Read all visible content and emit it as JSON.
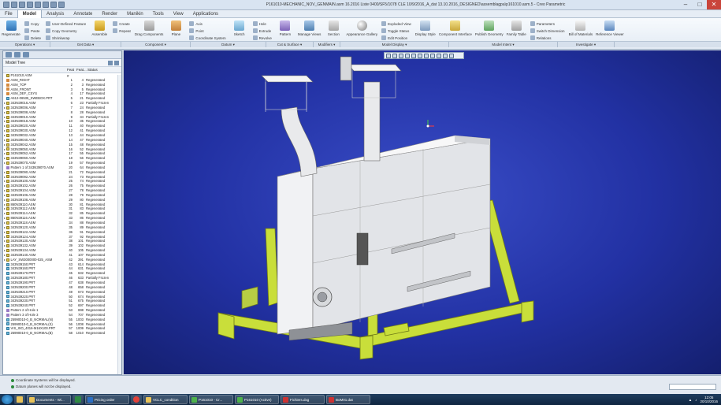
{
  "window": {
    "title": "P161010-MECHANIC_NOV_GENMAIN.asm 16.2016 Liste 0400/SF5/1078 CLE 10/9/2016_A_dat 13.10.2016_DESIGNED\\assemblagpa\\p161010.asm.5 - Creo Parametric"
  },
  "menu": {
    "tabs": [
      "File",
      "Model",
      "Analysis",
      "Annotate",
      "Render",
      "Manikin",
      "Tools",
      "View",
      "Applications"
    ],
    "active": "Model"
  },
  "ribbon": {
    "regenerate": "Regenerate",
    "copy": "Copy",
    "paste": "Paste",
    "delete": "Delete",
    "user_defined_feature": "User-Defined Feature",
    "copy_geometry": "Copy Geometry",
    "shrinkwrap": "Shrinkwrap",
    "assemble": "Assemble",
    "create": "Create",
    "repeat": "Repeat",
    "drag_components": "Drag Components",
    "plane": "Plane",
    "axis": "Axis",
    "point": "Point",
    "coord_system": "Coordinate System",
    "sketch": "Sketch",
    "hole": "Hole",
    "extrude": "Extrude",
    "revolve": "Revolve",
    "pattern": "Pattern",
    "manage_views": "Manage Views",
    "section": "Section",
    "appearance_gallery": "Appearance Gallery",
    "exploded_view": "Exploded View",
    "toggle_status": "Toggle Status",
    "edit_position": "Edit Position",
    "display_style": "Display Style",
    "component_interface": "Component Interface",
    "publish_geometry": "Publish Geometry",
    "family_table": "Family Table",
    "parameters": "Parameters",
    "switch_dimension": "Switch Dimension",
    "relations": "Relations",
    "bill_of_materials": "Bill of Materials",
    "reference_viewer": "Reference Viewer"
  },
  "groups": [
    "Operations ▾",
    "Get Data ▾",
    "Component ▾",
    "Datum ▾",
    "Cut & Surface ▾",
    "Modifiers ▾",
    "Model Display ▾",
    "Model Intent ▾",
    "Investigate ▾"
  ],
  "model_tree": {
    "title": "Model Tree",
    "columns": [
      "",
      "Feat #",
      "Feat...",
      "Status"
    ],
    "rows": [
      {
        "icon": "asm",
        "name": "P161010.ASM",
        "n": "",
        "id": "",
        "status": "",
        "top": true
      },
      {
        "icon": "dtm",
        "name": "ASM_RIGHT",
        "n": "1",
        "id": "4",
        "status": "Regenerated"
      },
      {
        "icon": "dtm",
        "name": "ASM_TOP",
        "n": "2",
        "id": "3",
        "status": "Regenerated"
      },
      {
        "icon": "dtm",
        "name": "ASM_FRONT",
        "n": "3",
        "id": "5",
        "status": "Regenerated"
      },
      {
        "icon": "dtm",
        "name": "ASM_DEF_CSYS",
        "n": "4",
        "id": "17",
        "status": "Regenerated"
      },
      {
        "icon": "prt",
        "name": "A612-06535_SWEBOX.PRT",
        "n": "5",
        "id": "21",
        "status": "Regenerated"
      },
      {
        "icon": "asm",
        "name": "343N39016.ASM",
        "n": "6",
        "id": "23",
        "status": "Partially Frozen"
      },
      {
        "icon": "asm",
        "name": "343N39006.ASM",
        "n": "7",
        "id": "24",
        "status": "Regenerated"
      },
      {
        "icon": "asm",
        "name": "343N39008.ASM",
        "n": "8",
        "id": "28",
        "status": "Regenerated"
      },
      {
        "icon": "asm",
        "name": "343N39010.ASM",
        "n": "9",
        "id": "34",
        "status": "Partially Frozen"
      },
      {
        "icon": "asm",
        "name": "343N39018.ASM",
        "n": "10",
        "id": "35",
        "status": "Regenerated"
      },
      {
        "icon": "asm",
        "name": "343N39020.ASM",
        "n": "11",
        "id": "40",
        "status": "Regenerated"
      },
      {
        "icon": "asm",
        "name": "343N39030.ASM",
        "n": "12",
        "id": "41",
        "status": "Regenerated"
      },
      {
        "icon": "asm",
        "name": "343N39032.ASM",
        "n": "13",
        "id": "44",
        "status": "Regenerated"
      },
      {
        "icon": "asm",
        "name": "343N39040.ASM",
        "n": "14",
        "id": "47",
        "status": "Regenerated"
      },
      {
        "icon": "asm",
        "name": "343N39042.ASM",
        "n": "15",
        "id": "48",
        "status": "Regenerated"
      },
      {
        "icon": "asm",
        "name": "343N39050.ASM",
        "n": "16",
        "id": "52",
        "status": "Regenerated"
      },
      {
        "icon": "asm",
        "name": "343N39052.ASM",
        "n": "17",
        "id": "55",
        "status": "Regenerated"
      },
      {
        "icon": "asm",
        "name": "343N39060.ASM",
        "n": "18",
        "id": "56",
        "status": "Regenerated"
      },
      {
        "icon": "asm",
        "name": "343N39070.ASM",
        "n": "19",
        "id": "57",
        "status": "Regenerated"
      },
      {
        "icon": "pat",
        "name": "Pattern 1 of 343N39070.ASM",
        "n": "20",
        "id": "64",
        "status": "Regenerated"
      },
      {
        "icon": "asm",
        "name": "343N39090.ASM",
        "n": "21",
        "id": "72",
        "status": "Regenerated"
      },
      {
        "icon": "asm",
        "name": "343N39092.ASM",
        "n": "24",
        "id": "73",
        "status": "Regenerated"
      },
      {
        "icon": "asm",
        "name": "343N39100.ASM",
        "n": "25",
        "id": "74",
        "status": "Regenerated"
      },
      {
        "icon": "asm",
        "name": "343N39102.ASM",
        "n": "26",
        "id": "75",
        "status": "Regenerated"
      },
      {
        "icon": "asm",
        "name": "343N39104.ASM",
        "n": "27",
        "id": "78",
        "status": "Regenerated"
      },
      {
        "icon": "asm",
        "name": "343N39106.ASM",
        "n": "28",
        "id": "79",
        "status": "Regenerated"
      },
      {
        "icon": "asm",
        "name": "343N39108.ASM",
        "n": "29",
        "id": "80",
        "status": "Regenerated"
      },
      {
        "icon": "asm",
        "name": "860N39110.ASM",
        "n": "30",
        "id": "81",
        "status": "Regenerated"
      },
      {
        "icon": "asm",
        "name": "343N39112.ASM",
        "n": "31",
        "id": "83",
        "status": "Regenerated"
      },
      {
        "icon": "asm",
        "name": "343N39114.ASM",
        "n": "32",
        "id": "85",
        "status": "Regenerated"
      },
      {
        "icon": "asm",
        "name": "860N39116.ASM",
        "n": "33",
        "id": "86",
        "status": "Regenerated"
      },
      {
        "icon": "asm",
        "name": "343N39118.ASM",
        "n": "34",
        "id": "88",
        "status": "Regenerated"
      },
      {
        "icon": "asm",
        "name": "343N39120.ASM",
        "n": "35",
        "id": "89",
        "status": "Regenerated"
      },
      {
        "icon": "asm",
        "name": "343N39122.ASM",
        "n": "36",
        "id": "91",
        "status": "Regenerated"
      },
      {
        "icon": "asm",
        "name": "343N39124.ASM",
        "n": "37",
        "id": "92",
        "status": "Regenerated"
      },
      {
        "icon": "asm",
        "name": "343N39130.ASM",
        "n": "38",
        "id": "101",
        "status": "Regenerated"
      },
      {
        "icon": "asm",
        "name": "343N39132.ASM",
        "n": "39",
        "id": "102",
        "status": "Regenerated"
      },
      {
        "icon": "asm",
        "name": "343N39134.ASM",
        "n": "40",
        "id": "105",
        "status": "Regenerated"
      },
      {
        "icon": "asm",
        "name": "343N39140.ASM",
        "n": "41",
        "id": "107",
        "status": "Regenerated"
      },
      {
        "icon": "asm",
        "name": "LAY_SW3000000-025_ASM",
        "n": "42",
        "id": "391",
        "status": "Regenerated"
      },
      {
        "icon": "prt",
        "name": "343N39150.PRT",
        "n": "43",
        "id": "614",
        "status": "Regenerated"
      },
      {
        "icon": "prt",
        "name": "343N39160.PRT",
        "n": "44",
        "id": "631",
        "status": "Regenerated"
      },
      {
        "icon": "prt",
        "name": "343N39170.PRT",
        "n": "45",
        "id": "632",
        "status": "Regenerated"
      },
      {
        "icon": "prt",
        "name": "343N39180.PRT",
        "n": "46",
        "id": "633",
        "status": "Partially Frozen"
      },
      {
        "icon": "prt",
        "name": "343N39190.PRT",
        "n": "47",
        "id": "638",
        "status": "Regenerated"
      },
      {
        "icon": "prt",
        "name": "343N39200.PRT",
        "n": "48",
        "id": "658",
        "status": "Regenerated"
      },
      {
        "icon": "prt",
        "name": "343N39210.PRT",
        "n": "49",
        "id": "673",
        "status": "Regenerated"
      },
      {
        "icon": "prt",
        "name": "343N39220.PRT",
        "n": "50",
        "id": "674",
        "status": "Regenerated"
      },
      {
        "icon": "prt",
        "name": "343N39230.PRT",
        "n": "51",
        "id": "675",
        "status": "Regenerated"
      },
      {
        "icon": "prt",
        "name": "343N39240.PRT",
        "n": "52",
        "id": "697",
        "status": "Regenerated"
      },
      {
        "icon": "pat",
        "name": "Pattern 2 of Hole 1",
        "n": "53",
        "id": "698",
        "status": "Regenerated"
      },
      {
        "icon": "pat",
        "name": "Pattern 3 of Hole 3",
        "n": "54",
        "id": "707",
        "status": "Regenerated"
      },
      {
        "icon": "prt",
        "name": "25990010-0_B_NORMAL(N)",
        "n": "55",
        "id": "1003",
        "status": "Regenerated"
      },
      {
        "icon": "prt",
        "name": "25990010-0_B_NORMAL(S)",
        "n": "56",
        "id": "1008",
        "status": "Regenerated"
      },
      {
        "icon": "prt",
        "name": "VIS_ISO_4016-M16X100.PRT",
        "n": "57",
        "id": "1009",
        "status": "Regenerated"
      },
      {
        "icon": "prt",
        "name": "25990010-0_B_NORMAL(B)",
        "n": "58",
        "id": "1010",
        "status": "Regenerated"
      }
    ]
  },
  "status": {
    "line1": "Coordinate Systems will be displayed.",
    "line2": "Datum planes will not be displayed."
  },
  "taskbar": {
    "tasks": [
      "Documents - Wi...",
      "Pricing order",
      "VCLC_condition",
      "P161010 - Cr...",
      "P161010 (Active)",
      "Fichiers.dxg",
      "BoM01.dat"
    ],
    "clock_time": "12:05",
    "clock_date": "20/10/2016"
  },
  "colors": {
    "viewport_bg": "#2231a3",
    "frame": "#c9de3a",
    "body": "#e6e8ec"
  }
}
